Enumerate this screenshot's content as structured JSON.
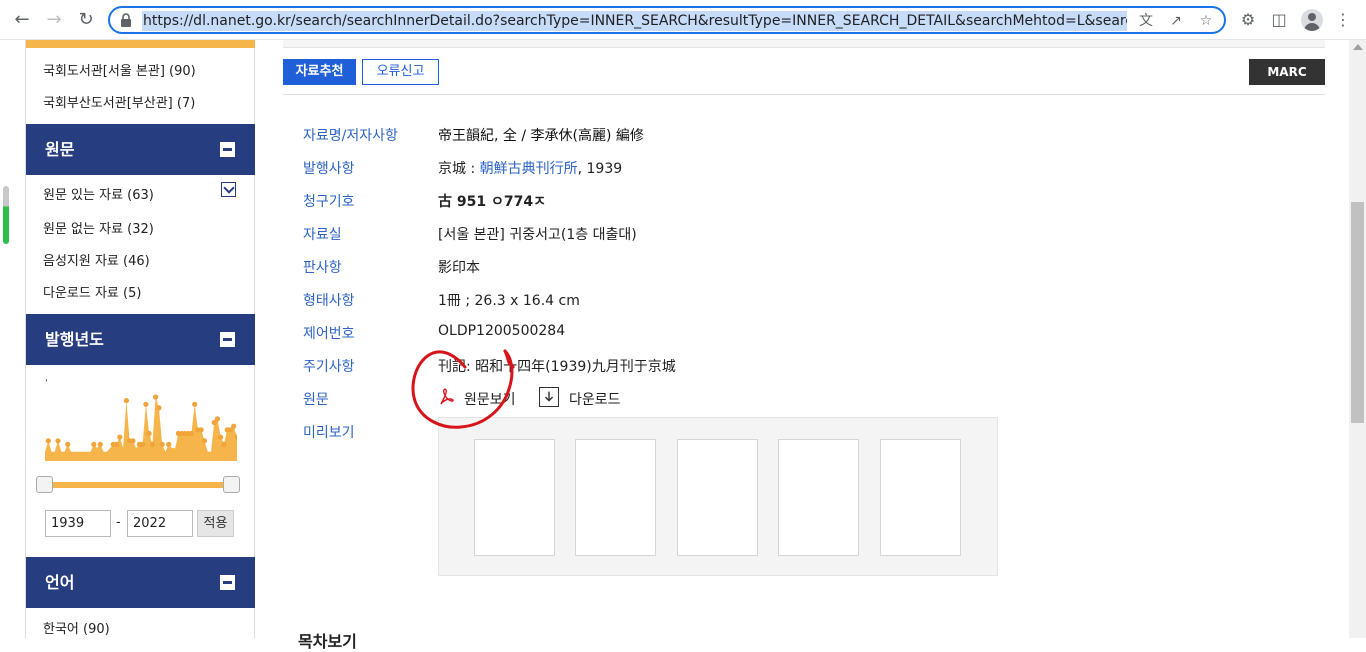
{
  "browser": {
    "url": "https://dl.nanet.go.kr/search/searchInnerDetail.do?searchType=INNER_SEARCH&resultType=INNER_SEARCH_DETAIL&searchMehtod=L&searchClas"
  },
  "sidebar": {
    "library_items": [
      {
        "label": "국회도서관[서울 본관] (90)"
      },
      {
        "label": "국회부산도서관[부산관] (7)"
      }
    ],
    "original_section": {
      "title": "원문",
      "items": [
        {
          "label": "원문 있는 자료 (63)",
          "checked": true
        },
        {
          "label": "원문 없는 자료 (32)"
        },
        {
          "label": "음성지원 자료 (46)"
        },
        {
          "label": "다운로드 자료 (5)"
        }
      ]
    },
    "year_section": {
      "title": "발행년도",
      "histogram_label": "'",
      "histogram_values": [
        2,
        5,
        2,
        2,
        5,
        2,
        2,
        4,
        2,
        2,
        2,
        2,
        2,
        2,
        2,
        4,
        3,
        4,
        2,
        2,
        3,
        4,
        4,
        6,
        3,
        16,
        5,
        5,
        3,
        4,
        4,
        15,
        7,
        4,
        17,
        14,
        4,
        2,
        4,
        3,
        3,
        7,
        7,
        7,
        7,
        7,
        15,
        8,
        8,
        5,
        2,
        2,
        10,
        11,
        6,
        4,
        8,
        8,
        9,
        6
      ],
      "from_year": "1939",
      "separator": "-",
      "to_year": "2022",
      "apply_label": "적용"
    },
    "language_section": {
      "title": "언어",
      "items": [
        {
          "label": "한국어 (90)"
        }
      ]
    }
  },
  "actions": {
    "recommend_label": "자료추천",
    "report_label": "오류신고",
    "marc_label": "MARC"
  },
  "record": {
    "title_label": "자료명/저자사항",
    "title_value": "帝王韻紀, 全 / 李承休(高麗) 編修",
    "publication_label": "발행사항",
    "publication_place": "京城 : ",
    "publication_publisher": "朝鮮古典刊行所",
    "publication_year": ", 1939",
    "call_number_label": "청구기호",
    "call_number_value": "古 951 ㅇ774ㅈ",
    "location_label": "자료실",
    "location_value": "[서울 본관] 귀중서고(1층 대출대)",
    "edition_label": "판사항",
    "edition_value": "影印本",
    "format_label": "형태사항",
    "format_value": "1冊 ; 26.3 x 16.4 cm",
    "control_label": "제어번호",
    "control_value": "OLDP1200500284",
    "note_label": "주기사항",
    "note_value": "刊記: 昭和十四年(1939)九月刊于京城",
    "original_label": "원문",
    "view_original_label": "원문보기",
    "download_label": "다운로드",
    "preview_label": "미리보기"
  },
  "bottom": {
    "heading": "목차보기"
  },
  "colors": {
    "navy": "#263d7f",
    "accent_orange": "#f6b54a",
    "link_blue": "#2d64c5",
    "button_blue": "#1f5fd7",
    "annotation_red": "#d8141b"
  }
}
